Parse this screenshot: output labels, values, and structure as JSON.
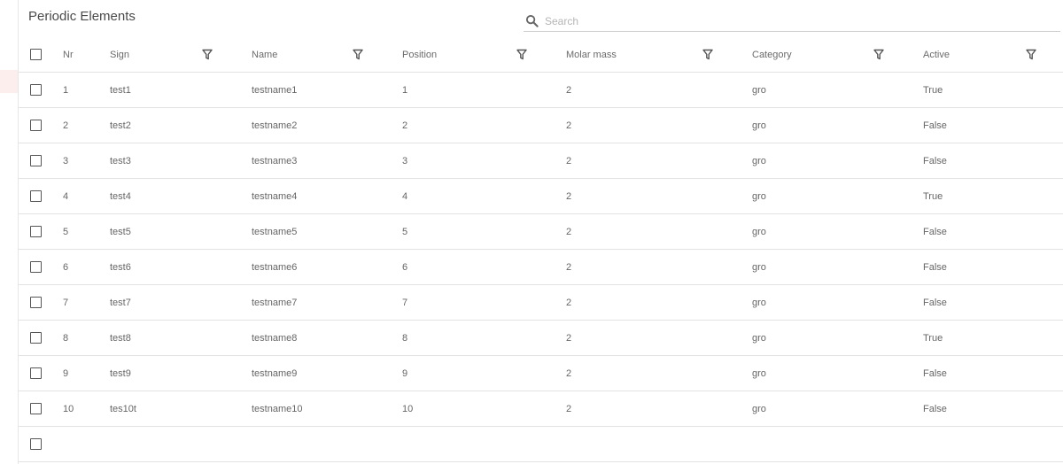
{
  "title": "Periodic Elements",
  "search": {
    "placeholder": "Search",
    "value": ""
  },
  "columns": {
    "nr": "Nr",
    "sign": "Sign",
    "name": "Name",
    "position": "Position",
    "molar_mass": "Molar mass",
    "category": "Category",
    "active": "Active"
  },
  "icons": {
    "search": "search-icon",
    "filter": "filter-icon",
    "checkbox": "checkbox"
  },
  "rows": [
    {
      "nr": "1",
      "sign": "test1",
      "name": "testname1",
      "position": "1",
      "molar_mass": "2",
      "category": "gro",
      "active": "True"
    },
    {
      "nr": "2",
      "sign": "test2",
      "name": "testname2",
      "position": "2",
      "molar_mass": "2",
      "category": "gro",
      "active": "False"
    },
    {
      "nr": "3",
      "sign": "test3",
      "name": "testname3",
      "position": "3",
      "molar_mass": "2",
      "category": "gro",
      "active": "False"
    },
    {
      "nr": "4",
      "sign": "test4",
      "name": "testname4",
      "position": "4",
      "molar_mass": "2",
      "category": "gro",
      "active": "True"
    },
    {
      "nr": "5",
      "sign": "test5",
      "name": "testname5",
      "position": "5",
      "molar_mass": "2",
      "category": "gro",
      "active": "False"
    },
    {
      "nr": "6",
      "sign": "test6",
      "name": "testname6",
      "position": "6",
      "molar_mass": "2",
      "category": "gro",
      "active": "False"
    },
    {
      "nr": "7",
      "sign": "test7",
      "name": "testname7",
      "position": "7",
      "molar_mass": "2",
      "category": "gro",
      "active": "False"
    },
    {
      "nr": "8",
      "sign": "test8",
      "name": "testname8",
      "position": "8",
      "molar_mass": "2",
      "category": "gro",
      "active": "True"
    },
    {
      "nr": "9",
      "sign": "test9",
      "name": "testname9",
      "position": "9",
      "molar_mass": "2",
      "category": "gro",
      "active": "False"
    },
    {
      "nr": "10",
      "sign": "tes10t",
      "name": "testname10",
      "position": "10",
      "molar_mass": "2",
      "category": "gro",
      "active": "False"
    },
    {
      "nr": "",
      "sign": "",
      "name": "",
      "position": "",
      "molar_mass": "",
      "category": "",
      "active": ""
    }
  ]
}
